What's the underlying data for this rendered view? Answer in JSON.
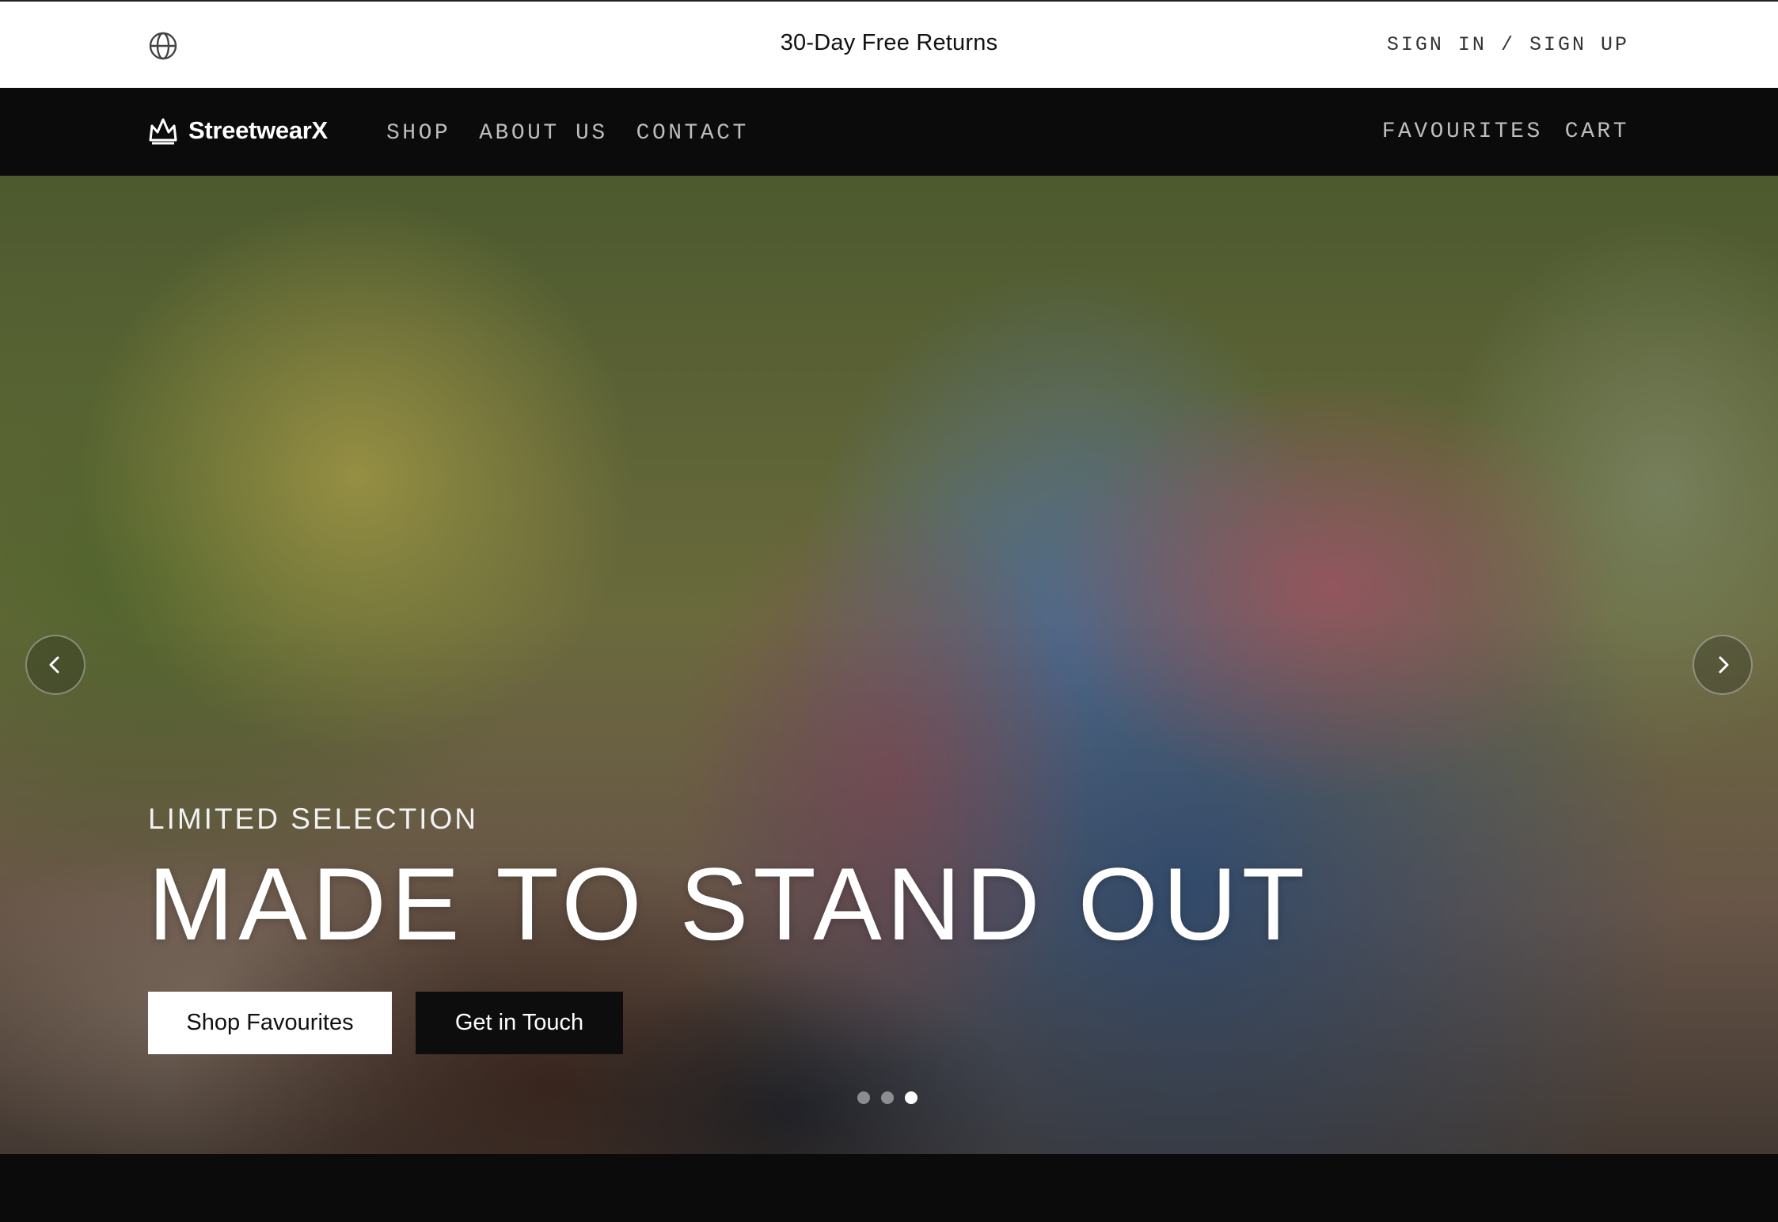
{
  "announcement": {
    "text": "30-Day Free Returns",
    "globe_icon": "globe-icon"
  },
  "auth": {
    "sign_in": "SIGN IN",
    "separator": "/",
    "sign_up": "SIGN UP"
  },
  "nav": {
    "brand": "StreetwearX",
    "brand_icon": "crown-icon",
    "links": [
      "SHOP",
      "ABOUT US",
      "CONTACT"
    ],
    "right_links": [
      "FAVOURITES",
      "CART"
    ]
  },
  "hero": {
    "eyebrow": "LIMITED SELECTION",
    "headline": "MADE TO STAND OUT",
    "primary_cta": "Shop Favourites",
    "secondary_cta": "Get in Touch",
    "slide_count": 3,
    "active_slide": 3,
    "prev_icon": "chevron-left-icon",
    "next_icon": "chevron-right-icon"
  },
  "colors": {
    "nav_bg": "#0b0b0b",
    "announce_bg": "#ffffff",
    "nav_text": "#bdbdbd",
    "cta_light": "#ffffff",
    "cta_dark": "#0d0d0d"
  }
}
